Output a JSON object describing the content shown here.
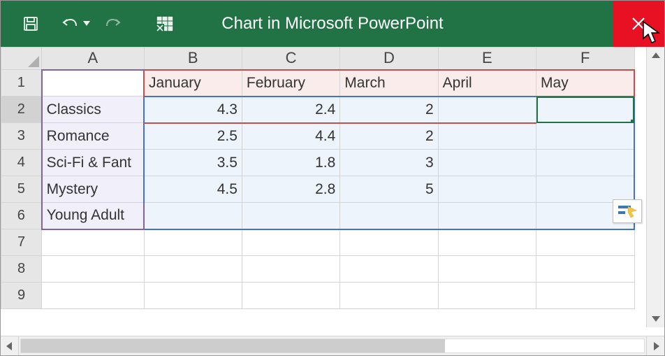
{
  "window": {
    "title": "Chart in Microsoft PowerPoint"
  },
  "columns": [
    "A",
    "B",
    "C",
    "D",
    "E",
    "F"
  ],
  "rowNumbers": [
    "1",
    "2",
    "3",
    "4",
    "5",
    "6",
    "7",
    "8",
    "9"
  ],
  "headerRow": {
    "B": "January",
    "C": "February",
    "D": "March",
    "E": "April",
    "F": "May"
  },
  "rows": [
    {
      "label": "Classics",
      "B": "4.3",
      "C": "2.4",
      "D": "2",
      "E": "",
      "F": ""
    },
    {
      "label": "Romance",
      "B": "2.5",
      "C": "4.4",
      "D": "2",
      "E": "",
      "F": ""
    },
    {
      "label": "Sci-Fi & Fantasy",
      "B": "3.5",
      "C": "1.8",
      "D": "3",
      "E": "",
      "F": ""
    },
    {
      "label": "Mystery",
      "B": "4.5",
      "C": "2.8",
      "D": "5",
      "E": "",
      "F": ""
    },
    {
      "label": "Young Adult",
      "B": "",
      "C": "",
      "D": "",
      "E": "",
      "F": ""
    }
  ],
  "rowLabelDisplay": {
    "0": "Classics",
    "1": "Romance",
    "2": "Sci-Fi & Fant",
    "3": "Mystery",
    "4": "Young Adult"
  },
  "activeCell": "F2",
  "chart_data": {
    "type": "bar",
    "categories": [
      "January",
      "February",
      "March",
      "April",
      "May"
    ],
    "series": [
      {
        "name": "Classics",
        "values": [
          4.3,
          2.4,
          2,
          null,
          null
        ]
      },
      {
        "name": "Romance",
        "values": [
          2.5,
          4.4,
          2,
          null,
          null
        ]
      },
      {
        "name": "Sci-Fi & Fantasy",
        "values": [
          3.5,
          1.8,
          3,
          null,
          null
        ]
      },
      {
        "name": "Mystery",
        "values": [
          4.5,
          2.8,
          5,
          null,
          null
        ]
      },
      {
        "name": "Young Adult",
        "values": [
          null,
          null,
          null,
          null,
          null
        ]
      }
    ],
    "title": "",
    "xlabel": "",
    "ylabel": ""
  }
}
